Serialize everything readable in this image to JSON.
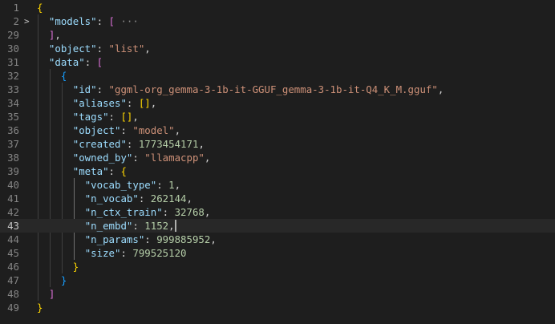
{
  "editor": {
    "language": "json",
    "current_line": "43",
    "lines": [
      {
        "ln": "1",
        "fold": "",
        "tokens": [
          [
            "{",
            "b1"
          ]
        ]
      },
      {
        "ln": "2",
        "fold": ">",
        "tokens": [
          [
            "  ",
            "punc"
          ],
          [
            "\"models\"",
            "key"
          ],
          [
            ": ",
            "punc"
          ],
          [
            "[",
            "b2"
          ],
          " ",
          [
            "···",
            "ell"
          ]
        ]
      },
      {
        "ln": "29",
        "fold": "",
        "tokens": [
          [
            "  ",
            "punc"
          ],
          [
            "]",
            "b2"
          ],
          [
            ",",
            "punc"
          ]
        ]
      },
      {
        "ln": "30",
        "fold": "",
        "tokens": [
          [
            "  ",
            "punc"
          ],
          [
            "\"object\"",
            "key"
          ],
          [
            ": ",
            "punc"
          ],
          [
            "\"list\"",
            "str"
          ],
          [
            ",",
            "punc"
          ]
        ]
      },
      {
        "ln": "31",
        "fold": "",
        "tokens": [
          [
            "  ",
            "punc"
          ],
          [
            "\"data\"",
            "key"
          ],
          [
            ": ",
            "punc"
          ],
          [
            "[",
            "b2"
          ]
        ]
      },
      {
        "ln": "32",
        "fold": "",
        "tokens": [
          [
            "    ",
            "punc"
          ],
          [
            "{",
            "b3"
          ]
        ]
      },
      {
        "ln": "33",
        "fold": "",
        "tokens": [
          [
            "      ",
            "punc"
          ],
          [
            "\"id\"",
            "key"
          ],
          [
            ": ",
            "punc"
          ],
          [
            "\"ggml-org_gemma-3-1b-it-GGUF_gemma-3-1b-it-Q4_K_M.gguf\"",
            "str"
          ],
          [
            ",",
            "punc"
          ]
        ]
      },
      {
        "ln": "34",
        "fold": "",
        "tokens": [
          [
            "      ",
            "punc"
          ],
          [
            "\"aliases\"",
            "key"
          ],
          [
            ": ",
            "punc"
          ],
          [
            "[]",
            "b1"
          ],
          [
            ",",
            "punc"
          ]
        ]
      },
      {
        "ln": "35",
        "fold": "",
        "tokens": [
          [
            "      ",
            "punc"
          ],
          [
            "\"tags\"",
            "key"
          ],
          [
            ": ",
            "punc"
          ],
          [
            "[]",
            "b1"
          ],
          [
            ",",
            "punc"
          ]
        ]
      },
      {
        "ln": "36",
        "fold": "",
        "tokens": [
          [
            "      ",
            "punc"
          ],
          [
            "\"object\"",
            "key"
          ],
          [
            ": ",
            "punc"
          ],
          [
            "\"model\"",
            "str"
          ],
          [
            ",",
            "punc"
          ]
        ]
      },
      {
        "ln": "37",
        "fold": "",
        "tokens": [
          [
            "      ",
            "punc"
          ],
          [
            "\"created\"",
            "key"
          ],
          [
            ": ",
            "punc"
          ],
          [
            "1773454171",
            "num"
          ],
          [
            ",",
            "punc"
          ]
        ]
      },
      {
        "ln": "38",
        "fold": "",
        "tokens": [
          [
            "      ",
            "punc"
          ],
          [
            "\"owned_by\"",
            "key"
          ],
          [
            ": ",
            "punc"
          ],
          [
            "\"llamacpp\"",
            "str"
          ],
          [
            ",",
            "punc"
          ]
        ]
      },
      {
        "ln": "39",
        "fold": "",
        "tokens": [
          [
            "      ",
            "punc"
          ],
          [
            "\"meta\"",
            "key"
          ],
          [
            ": ",
            "punc"
          ],
          [
            "{",
            "b1"
          ]
        ]
      },
      {
        "ln": "40",
        "fold": "",
        "tokens": [
          [
            "        ",
            "punc"
          ],
          [
            "\"vocab_type\"",
            "key"
          ],
          [
            ": ",
            "punc"
          ],
          [
            "1",
            "num"
          ],
          [
            ",",
            "punc"
          ]
        ]
      },
      {
        "ln": "41",
        "fold": "",
        "tokens": [
          [
            "        ",
            "punc"
          ],
          [
            "\"n_vocab\"",
            "key"
          ],
          [
            ": ",
            "punc"
          ],
          [
            "262144",
            "num"
          ],
          [
            ",",
            "punc"
          ]
        ]
      },
      {
        "ln": "42",
        "fold": "",
        "tokens": [
          [
            "        ",
            "punc"
          ],
          [
            "\"n_ctx_train\"",
            "key"
          ],
          [
            ": ",
            "punc"
          ],
          [
            "32768",
            "num"
          ],
          [
            ",",
            "punc"
          ]
        ]
      },
      {
        "ln": "43",
        "fold": "",
        "tokens": [
          [
            "        ",
            "punc"
          ],
          [
            "\"n_embd\"",
            "key"
          ],
          [
            ": ",
            "punc"
          ],
          [
            "1152",
            "num"
          ],
          [
            ",",
            "punc"
          ]
        ]
      },
      {
        "ln": "44",
        "fold": "",
        "tokens": [
          [
            "        ",
            "punc"
          ],
          [
            "\"n_params\"",
            "key"
          ],
          [
            ": ",
            "punc"
          ],
          [
            "999885952",
            "num"
          ],
          [
            ",",
            "punc"
          ]
        ]
      },
      {
        "ln": "45",
        "fold": "",
        "tokens": [
          [
            "        ",
            "punc"
          ],
          [
            "\"size\"",
            "key"
          ],
          [
            ": ",
            "punc"
          ],
          [
            "799525120",
            "num"
          ]
        ]
      },
      {
        "ln": "46",
        "fold": "",
        "tokens": [
          [
            "      ",
            "punc"
          ],
          [
            "}",
            "b1"
          ]
        ]
      },
      {
        "ln": "47",
        "fold": "",
        "tokens": [
          [
            "    ",
            "punc"
          ],
          [
            "}",
            "b3"
          ]
        ]
      },
      {
        "ln": "48",
        "fold": "",
        "tokens": [
          [
            "  ",
            "punc"
          ],
          [
            "]",
            "b2"
          ]
        ]
      },
      {
        "ln": "49",
        "fold": "",
        "tokens": [
          [
            "}",
            "b1"
          ]
        ]
      }
    ]
  },
  "colors": {
    "background": "#1e1e1e",
    "key": "#9cdcfe",
    "string": "#ce9178",
    "number": "#b5cea8",
    "bracket_level1": "#ffd700",
    "bracket_level2": "#da70d6",
    "bracket_level3": "#179fff"
  }
}
